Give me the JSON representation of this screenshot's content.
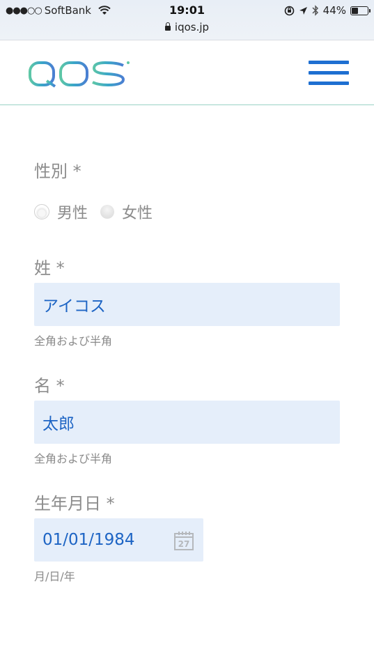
{
  "status_bar": {
    "carrier_dots": "●●●○○",
    "carrier": "SoftBank",
    "time": "19:01",
    "url": "iqos.jp",
    "battery": "44%"
  },
  "header": {
    "logo_text": "IQOS"
  },
  "form": {
    "gender": {
      "label": "性別 *",
      "options": [
        "男性",
        "女性"
      ]
    },
    "last_name": {
      "label": "姓 *",
      "value": "アイコス",
      "hint": "全角および半角"
    },
    "first_name": {
      "label": "名 *",
      "value": "太郎",
      "hint": "全角および半角"
    },
    "birthdate": {
      "label": "生年月日 *",
      "value": "01/01/1984",
      "calendar_day": "27",
      "hint": "月/日/年"
    }
  }
}
